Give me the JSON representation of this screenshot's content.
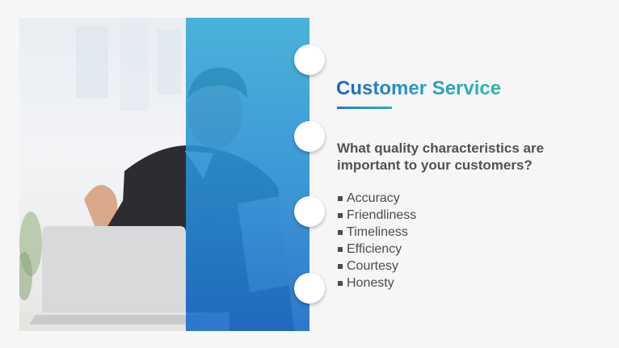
{
  "slide": {
    "title": "Customer Service",
    "question": "What quality characteristics are important to your customers?",
    "bullets": [
      "Accuracy",
      "Friendliness",
      "Timeliness",
      "Efficiency",
      "Courtesy",
      "Honesty"
    ]
  },
  "photo": {
    "subject": "businessman-celebrating-at-laptop"
  },
  "colors": {
    "title_gradient_start": "#1f63b8",
    "title_gradient_end": "#2fb8a6",
    "overlay_blue": "#2a8fd2",
    "body_text": "#505355"
  }
}
